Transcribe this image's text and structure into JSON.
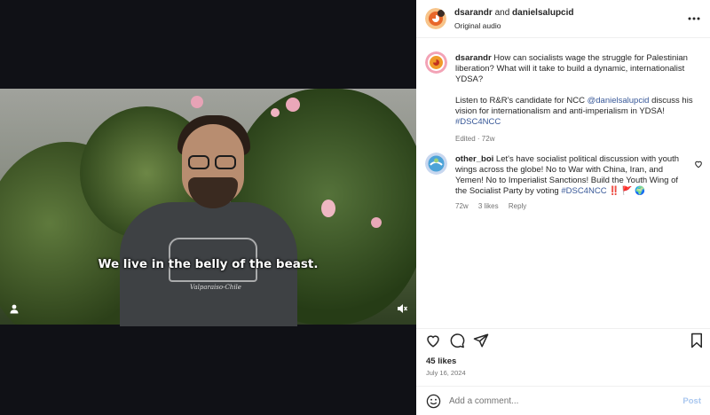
{
  "colors": {
    "link": "#385898",
    "muted": "#737373",
    "text": "#262626",
    "post_disabled": "#a9c7ef"
  },
  "video": {
    "subtitle": "We live in the belly of the beast.",
    "shirt_print": "Valparaiso-Chile",
    "icons": {
      "profile": "person-icon",
      "mute": "speaker-muted-icon"
    }
  },
  "header": {
    "user1": "dsarandr",
    "joiner": "and",
    "user2": "danielsalupcid",
    "subtitle": "Original audio",
    "more_icon": "more-horizontal-icon"
  },
  "caption": {
    "author": "dsarandr",
    "text1": "How can socialists wage the struggle for Palestinian liberation? What will it take to build a dynamic, internationalist YDSA?",
    "text2_pre": "Listen to R&R's candidate for NCC",
    "mention": "@danielsalupcid",
    "text2_post": "discuss his vision for internationalism and anti-imperialism in YDSA!",
    "hashtag": "#DSC4NCC",
    "meta": "Edited · 72w"
  },
  "comment": {
    "author": "other_boi",
    "text": "Let's have socialist political discussion with youth wings across the globe! No to War with China, Iran, and Yemen! No to Imperialist Sanctions! Build the Youth Wing of the Socialist Party by voting",
    "hashtag": "#DSC4NCC",
    "emojis": "‼️ 🚩 🌍",
    "age": "72w",
    "likes": "3 likes",
    "reply": "Reply"
  },
  "actions": {
    "like_icon": "heart-icon",
    "comment_icon": "comment-icon",
    "share_icon": "send-icon",
    "save_icon": "bookmark-icon"
  },
  "likes": "45 likes",
  "date": "July 16, 2024",
  "composer": {
    "placeholder": "Add a comment...",
    "post": "Post",
    "emoji_icon": "emoji-icon"
  }
}
